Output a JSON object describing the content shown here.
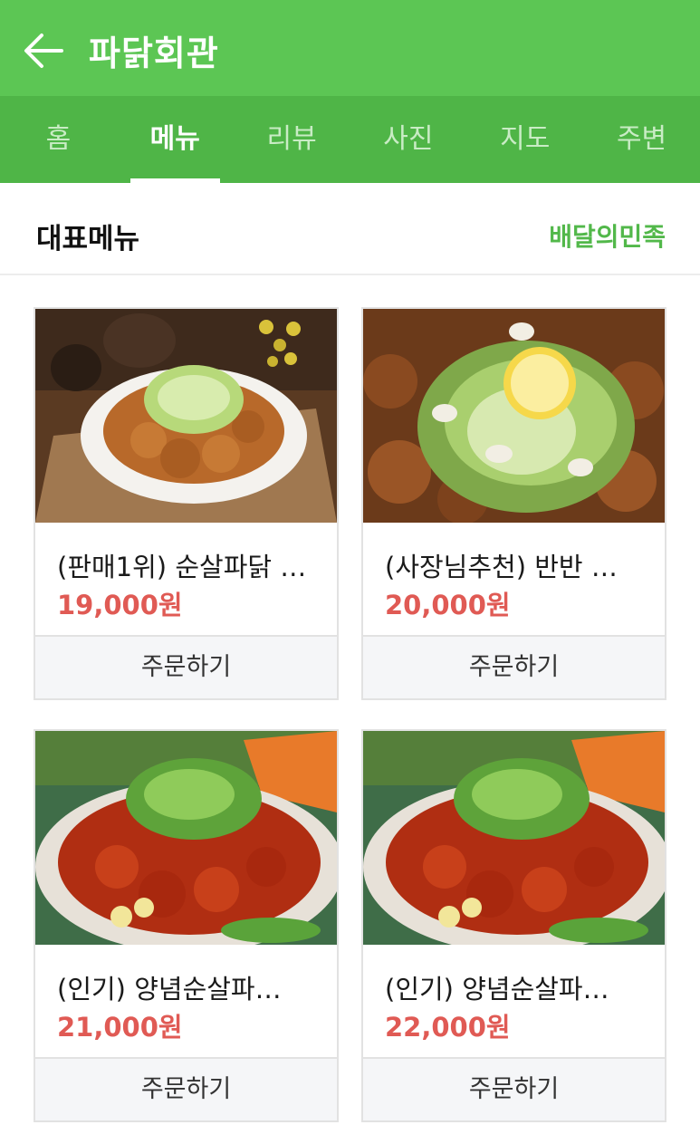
{
  "header": {
    "title": "파닭회관",
    "bg_color": "#5cc654",
    "back_icon": "arrow-left-icon"
  },
  "tabs": [
    {
      "label": "홈",
      "active": false
    },
    {
      "label": "메뉴",
      "active": true
    },
    {
      "label": "리뷰",
      "active": false
    },
    {
      "label": "사진",
      "active": false
    },
    {
      "label": "지도",
      "active": false
    },
    {
      "label": "주변",
      "active": false
    }
  ],
  "section": {
    "title": "대표메뉴",
    "link": "배달의민족"
  },
  "menu": [
    {
      "name": "(판매1위) 순살파닭 …",
      "price": "19,000원",
      "order_label": "주문하기",
      "image": "fried-chicken-scallion-plate"
    },
    {
      "name": "(사장님추천) 반반 …",
      "price": "20,000원",
      "order_label": "주문하기",
      "image": "chicken-scallion-lemon"
    },
    {
      "name": "(인기) 양념순살파…",
      "price": "21,000원",
      "order_label": "주문하기",
      "image": "seasoned-chicken-scallion"
    },
    {
      "name": "(인기) 양념순살파…",
      "price": "22,000원",
      "order_label": "주문하기",
      "image": "seasoned-chicken-scallion"
    }
  ],
  "colors": {
    "accent": "#52b84a",
    "price": "#e05a54"
  }
}
